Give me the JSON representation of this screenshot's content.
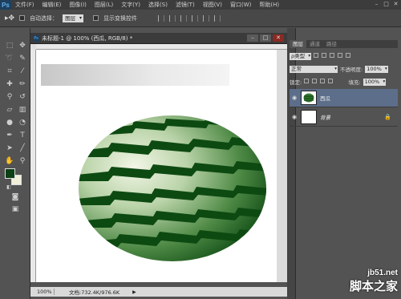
{
  "app": {
    "logo": "Ps"
  },
  "menu": [
    "文件(F)",
    "编辑(E)",
    "图像(I)",
    "图层(L)",
    "文字(Y)",
    "选择(S)",
    "滤镜(T)",
    "视图(V)",
    "窗口(W)",
    "帮助(H)"
  ],
  "window_controls": [
    "–",
    "□",
    "✕"
  ],
  "options_bar": {
    "auto_select_label": "自动选择：",
    "auto_select_value": "图层",
    "show_transform_label": "显示变换控件"
  },
  "document": {
    "title": "未标题-1 @ 100% (西瓜, RGB/8) *",
    "zoom": "100%",
    "doc_info": "文档:732.4K/976.6K"
  },
  "layers_panel": {
    "tabs": [
      "图层",
      "通道",
      "路径"
    ],
    "kind_filter": "ρ类型",
    "blend_mode": "正常",
    "opacity_label": "不透明度:",
    "opacity_value": "100%",
    "lock_label": "锁定:",
    "fill_label": "填充:",
    "fill_value": "100%",
    "layers": [
      {
        "name": "西瓜",
        "selected": true
      },
      {
        "name": "背景",
        "locked": true
      }
    ]
  },
  "watermark": {
    "site": "jb51.net",
    "name": "脚本之家"
  },
  "colors": {
    "foreground": "#0b3f14",
    "background": "#f1efd9",
    "watermelon_stripe": "#0d4a12"
  }
}
